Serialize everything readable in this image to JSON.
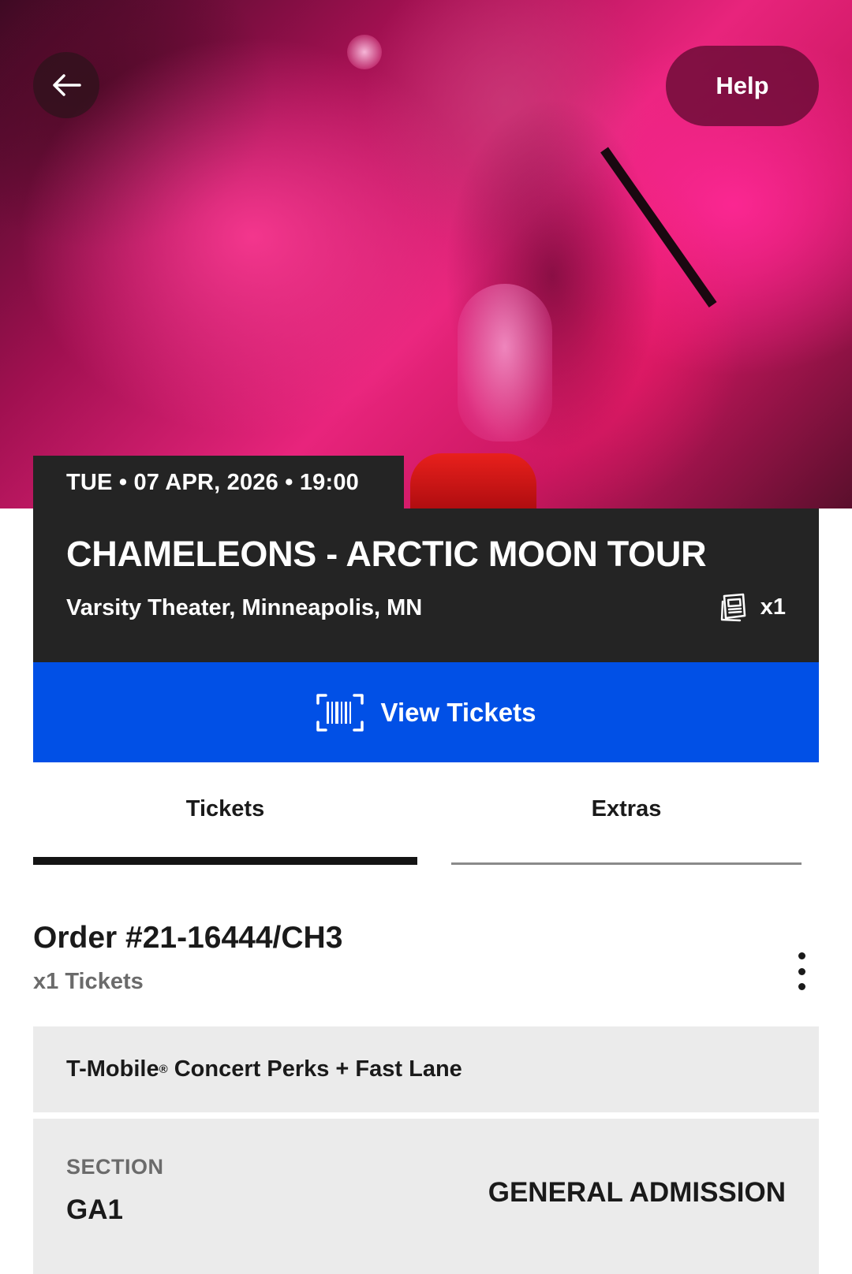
{
  "header": {
    "help_label": "Help",
    "back_icon": "arrow-left-icon"
  },
  "event": {
    "date_line": "TUE • 07 APR, 2026 • 19:00",
    "title": "CHAMELEONS - ARCTIC MOON TOUR",
    "venue": "Varsity Theater, Minneapolis, MN",
    "ticket_count": "x1",
    "ticket_icon": "tickets-icon"
  },
  "view_tickets": {
    "label": "View Tickets",
    "icon": "barcode-scan-icon"
  },
  "tabs": [
    {
      "label": "Tickets",
      "active": true
    },
    {
      "label": "Extras",
      "active": false
    }
  ],
  "order": {
    "title": "Order #21-16444/CH3",
    "subtitle": "x1 Tickets",
    "menu_icon": "more-vertical-icon"
  },
  "perk": {
    "name_prefix": "T-Mobile",
    "name_mark": "®",
    "name_suffix": " Concert Perks + Fast Lane"
  },
  "section": {
    "label": "SECTION",
    "value": "GA1",
    "admission": "GENERAL ADMISSION"
  },
  "colors": {
    "accent_blue": "#0150e6",
    "card_dark": "#242424",
    "hero_pink": "#e8247c"
  }
}
